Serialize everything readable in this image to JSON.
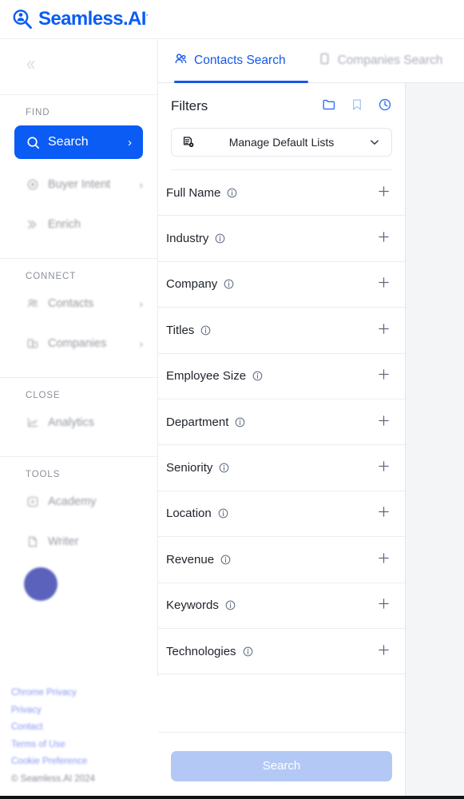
{
  "brand": {
    "name": "Seamless.AI",
    "trademark": "·",
    "color": "#0b5cf5",
    "logo_icon": "magnifier-person-icon"
  },
  "sidebar": {
    "collapse_icon": "collapse-chevrons-icon",
    "groups": [
      {
        "heading": "FIND",
        "items": [
          {
            "label": "Search",
            "icon": "search-icon",
            "chevron": "›",
            "active": true,
            "dim": false
          },
          {
            "label": "Buyer Intent",
            "icon": "target-icon",
            "chevron": "›",
            "active": false,
            "dim": true
          },
          {
            "label": "Enrich",
            "icon": "enrich-icon",
            "chevron": "",
            "active": false,
            "dim": true
          }
        ]
      },
      {
        "heading": "CONNECT",
        "items": [
          {
            "label": "Contacts",
            "icon": "contacts-icon",
            "chevron": "›",
            "active": false,
            "dim": true
          },
          {
            "label": "Companies",
            "icon": "companies-icon",
            "chevron": "›",
            "active": false,
            "dim": true
          }
        ]
      },
      {
        "heading": "CLOSE",
        "items": [
          {
            "label": "Analytics",
            "icon": "analytics-icon",
            "chevron": "",
            "active": false,
            "dim": true
          }
        ]
      },
      {
        "heading": "TOOLS",
        "items": [
          {
            "label": "Academy",
            "icon": "play-square-icon",
            "chevron": "",
            "active": false,
            "dim": true
          },
          {
            "label": "Writer",
            "icon": "document-icon",
            "chevron": "",
            "active": false,
            "dim": true
          }
        ]
      }
    ],
    "avatar": {
      "name": "avatar",
      "color": "#4a52b5"
    },
    "footer_links": [
      "Chrome Privacy",
      "Privacy",
      "Contact",
      "Terms of Use",
      "Cookie Preference"
    ],
    "copyright": "© Seamless.AI 2024"
  },
  "tabs": [
    {
      "label": "Contacts Search",
      "icon": "contacts-icon",
      "selected": true
    },
    {
      "label": "Companies Search",
      "icon": "building-icon",
      "selected": false
    }
  ],
  "filters_panel": {
    "title": "Filters",
    "header_icons": [
      {
        "name": "folder-icon",
        "color": "#2a6df4"
      },
      {
        "name": "bookmark-icon",
        "color": "#a9c6f8"
      },
      {
        "name": "clock-icon",
        "color": "#2a6df4"
      }
    ],
    "dropdown": {
      "icon": "list-settings-icon",
      "label": "Manage Default Lists",
      "chevron_icon": "chevron-down-icon"
    },
    "rows": [
      {
        "label": "Full Name",
        "info_icon": "info-icon",
        "add_icon": "plus-icon"
      },
      {
        "label": "Industry",
        "info_icon": "info-icon",
        "add_icon": "plus-icon"
      },
      {
        "label": "Company",
        "info_icon": "info-icon",
        "add_icon": "plus-icon"
      },
      {
        "label": "Titles",
        "info_icon": "info-icon",
        "add_icon": "plus-icon"
      },
      {
        "label": "Employee Size",
        "info_icon": "info-icon",
        "add_icon": "plus-icon"
      },
      {
        "label": "Department",
        "info_icon": "info-icon",
        "add_icon": "plus-icon"
      },
      {
        "label": "Seniority",
        "info_icon": "info-icon",
        "add_icon": "plus-icon"
      },
      {
        "label": "Location",
        "info_icon": "info-icon",
        "add_icon": "plus-icon"
      },
      {
        "label": "Revenue",
        "info_icon": "info-icon",
        "add_icon": "plus-icon"
      },
      {
        "label": "Keywords",
        "info_icon": "info-icon",
        "add_icon": "plus-icon"
      },
      {
        "label": "Technologies",
        "info_icon": "info-icon",
        "add_icon": "plus-icon"
      }
    ],
    "search_button": {
      "label": "Search",
      "enabled": false,
      "color": "#b3c8f5"
    }
  }
}
